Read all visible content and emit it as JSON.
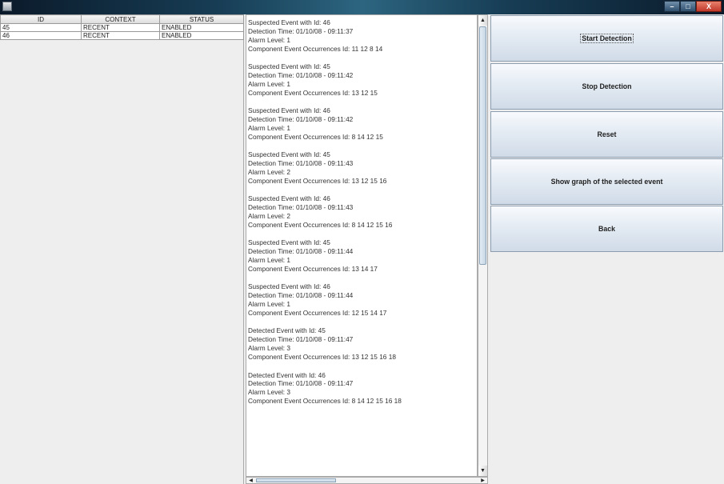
{
  "window": {
    "title": "",
    "controls": {
      "minimize": "–",
      "maximize": "□",
      "close": "X"
    }
  },
  "table": {
    "columns": [
      "ID",
      "CONTEXT",
      "STATUS"
    ],
    "rows": [
      [
        "45",
        "RECENT",
        "ENABLED"
      ],
      [
        "46",
        "RECENT",
        "ENABLED"
      ]
    ]
  },
  "log": {
    "entries": [
      [
        "Suspected Event with Id: 46",
        "Detection Time: 01/10/08 - 09:11:37",
        "Alarm Level: 1",
        "Component Event Occurrences Id: 11 12 8 14"
      ],
      [
        "Suspected Event with Id: 45",
        "Detection Time: 01/10/08 - 09:11:42",
        "Alarm Level: 1",
        "Component Event Occurrences Id: 13 12 15"
      ],
      [
        "Suspected Event with Id: 46",
        "Detection Time: 01/10/08 - 09:11:42",
        "Alarm Level: 1",
        "Component Event Occurrences Id: 8 14 12 15"
      ],
      [
        "Suspected Event with Id: 45",
        "Detection Time: 01/10/08 - 09:11:43",
        "Alarm Level: 2",
        "Component Event Occurrences Id: 13 12 15 16"
      ],
      [
        "Suspected Event with Id: 46",
        "Detection Time: 01/10/08 - 09:11:43",
        "Alarm Level: 2",
        "Component Event Occurrences Id: 8 14 12 15 16"
      ],
      [
        "Suspected Event with Id: 45",
        "Detection Time: 01/10/08 - 09:11:44",
        "Alarm Level: 1",
        "Component Event Occurrences Id: 13 14 17"
      ],
      [
        "Suspected Event with Id: 46",
        "Detection Time: 01/10/08 - 09:11:44",
        "Alarm Level: 1",
        "Component Event Occurrences Id: 12 15 14 17"
      ],
      [
        "Detected Event with Id: 45",
        "Detection Time: 01/10/08 - 09:11:47",
        "Alarm Level: 3",
        "Component Event Occurrences Id: 13 12 15 16 18"
      ],
      [
        "Detected Event with Id: 46",
        "Detection Time: 01/10/08 - 09:11:47",
        "Alarm Level: 3",
        "Component Event Occurrences Id: 8 14 12 15 16 18"
      ]
    ]
  },
  "scrollbar": {
    "up": "▲",
    "down": "▼",
    "left": "◀",
    "right": "▶"
  },
  "buttons": {
    "start": "Start Detection",
    "stop": "Stop Detection",
    "reset": "Reset",
    "show_graph": "Show graph of the selected event",
    "back": "Back"
  }
}
